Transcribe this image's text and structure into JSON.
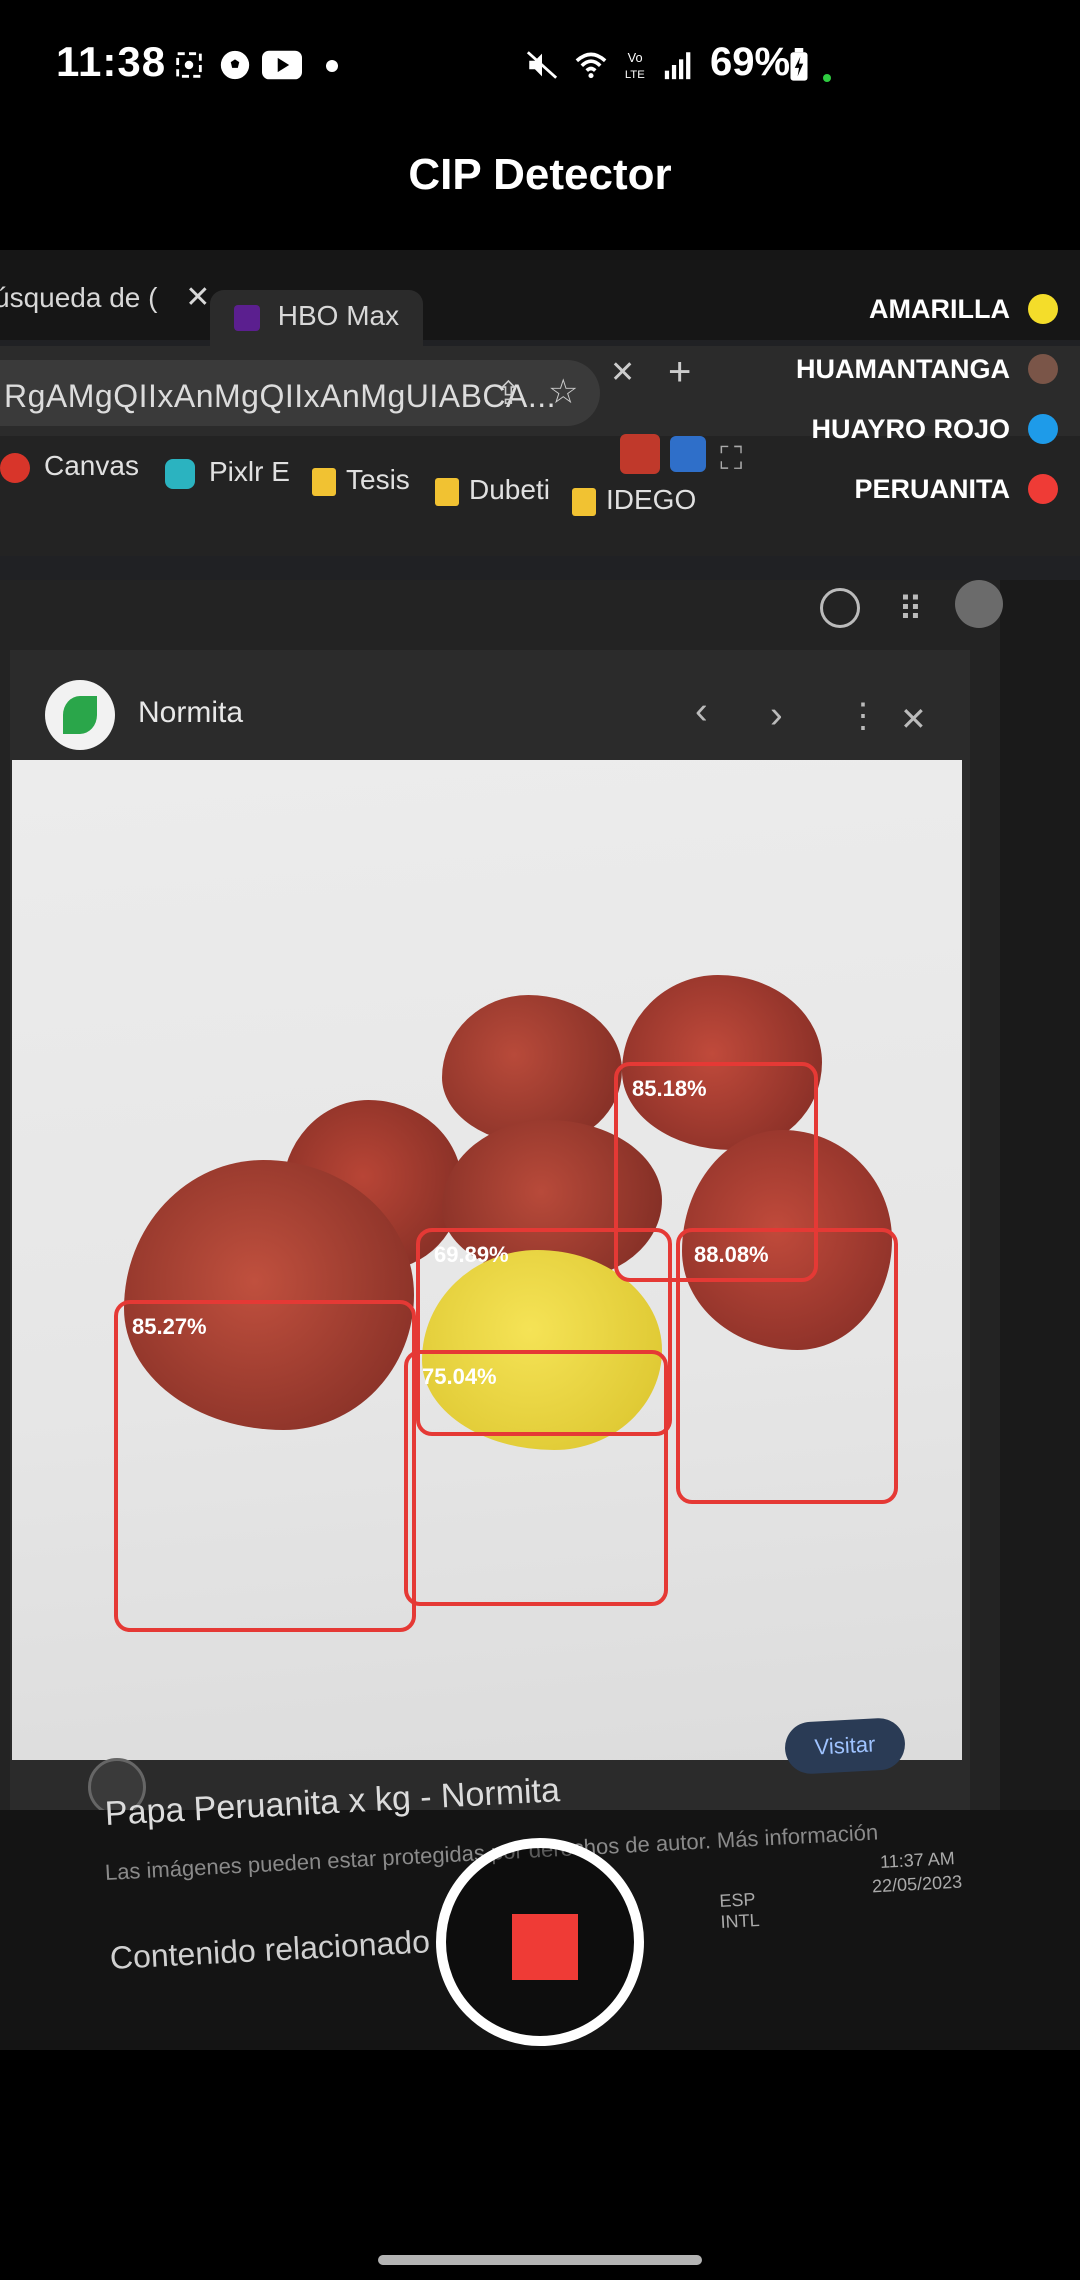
{
  "status_bar": {
    "time": "11:38",
    "battery": "69%"
  },
  "app": {
    "title": "CIP Detector"
  },
  "browser": {
    "tabs": [
      "úsqueda de (",
      "HBO Max"
    ],
    "url": "RgAMgQIIxAnMgQIIxAnMgUIABCA...",
    "bookmarks": [
      "Canvas",
      "Pixlr E",
      "Tesis",
      "Dubeti",
      "IDEGO"
    ]
  },
  "panel": {
    "site_name": "Normita"
  },
  "legend": [
    {
      "label": "AMARILLA",
      "color": "#f4dd2a"
    },
    {
      "label": "HUAMANTANGA",
      "color": "#7a5548"
    },
    {
      "label": "HUAYRO ROJO",
      "color": "#1e9be9"
    },
    {
      "label": "PERUANITA",
      "color": "#ef3b36"
    }
  ],
  "detections": [
    {
      "label": "85.18%",
      "color": "#e53935"
    },
    {
      "label": "69.89%",
      "color": "#e53935"
    },
    {
      "label": "88.08%",
      "color": "#e53935"
    },
    {
      "label": "85.27%",
      "color": "#e53935"
    },
    {
      "label": "75.04%",
      "color": "#e53935"
    }
  ],
  "page_text": {
    "product_title": "Papa Peruanita x kg - Normita",
    "note": "Las imágenes pueden estar protegidas por derechos de autor. Más información",
    "visit_button": "Visitar",
    "related": "Contenido relacionado",
    "taskbar_lang": "ESP INTL",
    "taskbar_time": "11:37 AM",
    "taskbar_date": "22/05/2023"
  },
  "controls": {
    "record_state": "recording"
  }
}
